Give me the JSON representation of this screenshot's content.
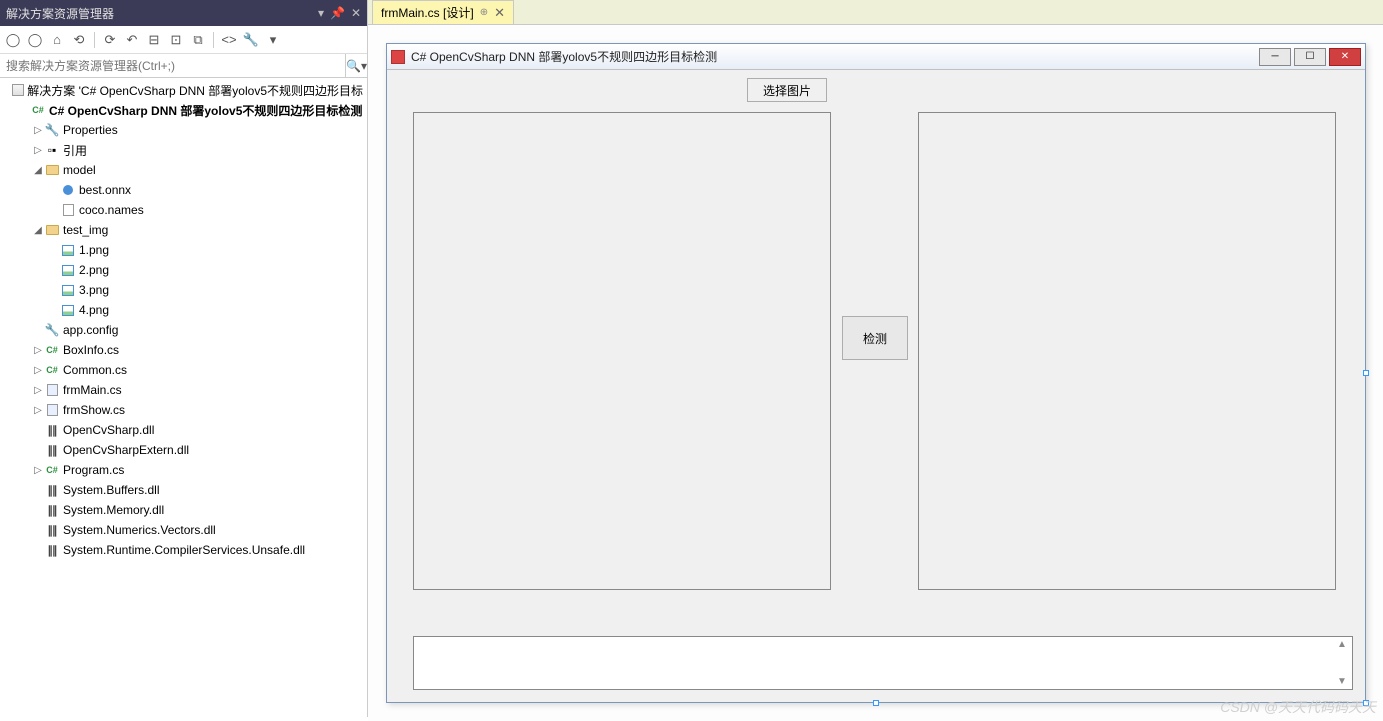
{
  "solution_explorer": {
    "title": "解决方案资源管理器",
    "search_placeholder": "搜索解决方案资源管理器(Ctrl+;)",
    "tree": [
      {
        "indent": 0,
        "exp": "",
        "icon": "sol",
        "label": "解决方案 'C# OpenCvSharp DNN 部署yolov5不规则四边形目标",
        "bold": false,
        "interact": true
      },
      {
        "indent": 1,
        "exp": "",
        "icon": "cs",
        "label": "C# OpenCvSharp DNN 部署yolov5不规则四边形目标检测",
        "bold": true,
        "interact": true
      },
      {
        "indent": 2,
        "exp": "▷",
        "icon": "wrench",
        "label": "Properties",
        "bold": false,
        "interact": true
      },
      {
        "indent": 2,
        "exp": "▷",
        "icon": "ref",
        "label": "引用",
        "bold": false,
        "interact": true
      },
      {
        "indent": 2,
        "exp": "◢",
        "icon": "folder",
        "label": "model",
        "bold": false,
        "interact": true
      },
      {
        "indent": 3,
        "exp": "",
        "icon": "onnx",
        "label": "best.onnx",
        "bold": false,
        "interact": true
      },
      {
        "indent": 3,
        "exp": "",
        "icon": "file",
        "label": "coco.names",
        "bold": false,
        "interact": true
      },
      {
        "indent": 2,
        "exp": "◢",
        "icon": "folder",
        "label": "test_img",
        "bold": false,
        "interact": true
      },
      {
        "indent": 3,
        "exp": "",
        "icon": "img",
        "label": "1.png",
        "bold": false,
        "interact": true
      },
      {
        "indent": 3,
        "exp": "",
        "icon": "img",
        "label": "2.png",
        "bold": false,
        "interact": true
      },
      {
        "indent": 3,
        "exp": "",
        "icon": "img",
        "label": "3.png",
        "bold": false,
        "interact": true
      },
      {
        "indent": 3,
        "exp": "",
        "icon": "img",
        "label": "4.png",
        "bold": false,
        "interact": true
      },
      {
        "indent": 2,
        "exp": "",
        "icon": "wrench",
        "label": "app.config",
        "bold": false,
        "interact": true
      },
      {
        "indent": 2,
        "exp": "▷",
        "icon": "cs",
        "label": "BoxInfo.cs",
        "bold": false,
        "interact": true
      },
      {
        "indent": 2,
        "exp": "▷",
        "icon": "cs",
        "label": "Common.cs",
        "bold": false,
        "interact": true
      },
      {
        "indent": 2,
        "exp": "▷",
        "icon": "form",
        "label": "frmMain.cs",
        "bold": false,
        "interact": true
      },
      {
        "indent": 2,
        "exp": "▷",
        "icon": "form",
        "label": "frmShow.cs",
        "bold": false,
        "interact": true
      },
      {
        "indent": 2,
        "exp": "",
        "icon": "dll",
        "label": "OpenCvSharp.dll",
        "bold": false,
        "interact": true
      },
      {
        "indent": 2,
        "exp": "",
        "icon": "dll",
        "label": "OpenCvSharpExtern.dll",
        "bold": false,
        "interact": true
      },
      {
        "indent": 2,
        "exp": "▷",
        "icon": "cs",
        "label": "Program.cs",
        "bold": false,
        "interact": true
      },
      {
        "indent": 2,
        "exp": "",
        "icon": "dll",
        "label": "System.Buffers.dll",
        "bold": false,
        "interact": true
      },
      {
        "indent": 2,
        "exp": "",
        "icon": "dll",
        "label": "System.Memory.dll",
        "bold": false,
        "interact": true
      },
      {
        "indent": 2,
        "exp": "",
        "icon": "dll",
        "label": "System.Numerics.Vectors.dll",
        "bold": false,
        "interact": true
      },
      {
        "indent": 2,
        "exp": "",
        "icon": "dll",
        "label": "System.Runtime.CompilerServices.Unsafe.dll",
        "bold": false,
        "interact": true
      }
    ]
  },
  "tab": {
    "label": "frmMain.cs [设计]"
  },
  "form": {
    "title": "C# OpenCvSharp DNN 部署yolov5不规则四边形目标检测",
    "btn_select": "选择图片",
    "btn_detect": "检测"
  },
  "watermark": "CSDN @天天代码码天天"
}
